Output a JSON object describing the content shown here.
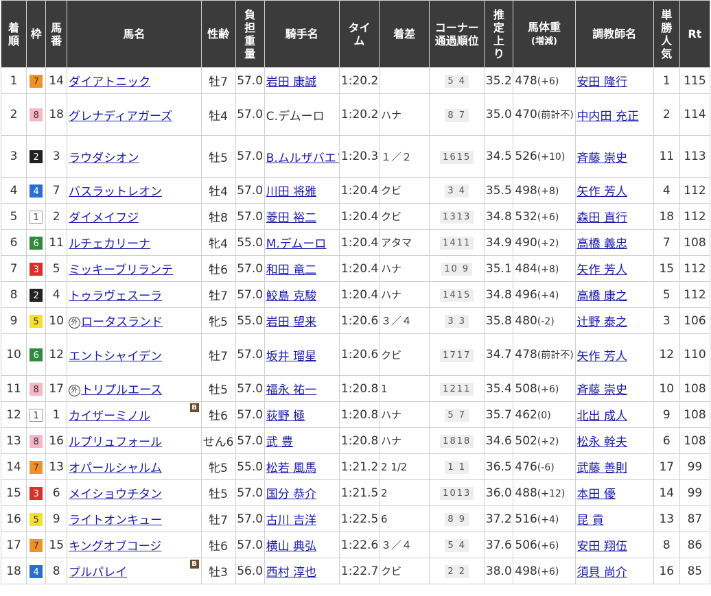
{
  "headers": {
    "rank": "着順",
    "waku": "枠",
    "umaban": "馬番",
    "name": "馬名",
    "sexage": "性齢",
    "weight": "負担重量",
    "jockey": "騎手名",
    "time": "タイム",
    "margin": "着差",
    "corner": "コーナー通過順位",
    "last3f": "推定上り",
    "bodyweight": "馬体重",
    "bodyweight_sub": "(増減)",
    "trainer": "調教師名",
    "pop": "単勝人気",
    "rt": "Rt"
  },
  "waku_colors": {
    "1": {
      "bg": "#ffffff",
      "fg": "#333333"
    },
    "2": {
      "bg": "#222222",
      "fg": "#ffffff"
    },
    "3": {
      "bg": "#d9302c",
      "fg": "#ffffff"
    },
    "4": {
      "bg": "#2a6fcf",
      "fg": "#ffffff"
    },
    "5": {
      "bg": "#f5e02a",
      "fg": "#333333"
    },
    "6": {
      "bg": "#2f8a3c",
      "fg": "#ffffff"
    },
    "7": {
      "bg": "#f0922a",
      "fg": "#333333"
    },
    "8": {
      "bg": "#f6b6c6",
      "fg": "#333333"
    }
  },
  "rows": [
    {
      "rank": "1",
      "waku": "7",
      "umaban": "14",
      "name": "ダイアトニック",
      "gai": false,
      "blinker": false,
      "sexage": "牡7",
      "weight": "57.0",
      "jockey": "岩田 康誠",
      "time": "1:20.2",
      "margin": "",
      "corner": "5 4",
      "last3f": "35.2",
      "bw": "478",
      "bwd": "(+6)",
      "trainer": "安田 隆行",
      "pop": "1",
      "rt": "115"
    },
    {
      "rank": "2",
      "waku": "8",
      "umaban": "18",
      "name": "グレナディアガーズ",
      "gai": false,
      "blinker": false,
      "sexage": "牡4",
      "weight": "57.0",
      "jockey": "C.デムーロ",
      "jockey_plain": true,
      "time": "1:20.2",
      "margin": "ハナ",
      "corner": "8 7",
      "last3f": "35.0",
      "bw": "470",
      "bwd": "(前計不)",
      "trainer": "中内田 充正",
      "pop": "2",
      "rt": "114"
    },
    {
      "rank": "3",
      "waku": "2",
      "umaban": "3",
      "name": "ラウダシオン",
      "gai": false,
      "blinker": false,
      "sexage": "牡5",
      "weight": "57.0",
      "jockey": "B.ムルザバエフ",
      "time": "1:20.3",
      "margin": "１／２",
      "corner": "1615",
      "last3f": "34.5",
      "bw": "526",
      "bwd": "(+10)",
      "trainer": "斉藤 崇史",
      "pop": "11",
      "rt": "113"
    },
    {
      "rank": "4",
      "waku": "4",
      "umaban": "7",
      "name": "バスラットレオン",
      "gai": false,
      "blinker": false,
      "sexage": "牡4",
      "weight": "57.0",
      "jockey": "川田 将雅",
      "time": "1:20.4",
      "margin": "クビ",
      "corner": "3 4",
      "last3f": "35.5",
      "bw": "498",
      "bwd": "(+8)",
      "trainer": "矢作 芳人",
      "pop": "4",
      "rt": "112"
    },
    {
      "rank": "5",
      "waku": "1",
      "umaban": "2",
      "name": "ダイメイフジ",
      "gai": false,
      "blinker": false,
      "sexage": "牡8",
      "weight": "57.0",
      "jockey": "菱田 裕二",
      "time": "1:20.4",
      "margin": "クビ",
      "corner": "1313",
      "last3f": "34.8",
      "bw": "532",
      "bwd": "(+6)",
      "trainer": "森田 直行",
      "pop": "18",
      "rt": "112"
    },
    {
      "rank": "6",
      "waku": "6",
      "umaban": "11",
      "name": "ルチェカリーナ",
      "gai": false,
      "blinker": false,
      "sexage": "牝4",
      "weight": "55.0",
      "jockey": "M.デムーロ",
      "time": "1:20.4",
      "margin": "アタマ",
      "corner": "1411",
      "last3f": "34.9",
      "bw": "490",
      "bwd": "(+2)",
      "trainer": "高橋 義忠",
      "pop": "7",
      "rt": "108"
    },
    {
      "rank": "7",
      "waku": "3",
      "umaban": "5",
      "name": "ミッキーブリランテ",
      "gai": false,
      "blinker": false,
      "sexage": "牡6",
      "weight": "57.0",
      "jockey": "和田 竜二",
      "time": "1:20.4",
      "margin": "ハナ",
      "corner": "10 9",
      "last3f": "35.1",
      "bw": "484",
      "bwd": "(+8)",
      "trainer": "矢作 芳人",
      "pop": "15",
      "rt": "112"
    },
    {
      "rank": "8",
      "waku": "2",
      "umaban": "4",
      "name": "トゥラヴェスーラ",
      "gai": false,
      "blinker": false,
      "sexage": "牡7",
      "weight": "57.0",
      "jockey": "鮫島 克駿",
      "time": "1:20.4",
      "margin": "ハナ",
      "corner": "1415",
      "last3f": "34.8",
      "bw": "496",
      "bwd": "(+4)",
      "trainer": "高橋 康之",
      "pop": "5",
      "rt": "112"
    },
    {
      "rank": "9",
      "waku": "5",
      "umaban": "10",
      "name": "ロータスランド",
      "gai": true,
      "blinker": false,
      "sexage": "牝5",
      "weight": "55.0",
      "jockey": "岩田 望来",
      "time": "1:20.6",
      "margin": "３／４",
      "corner": "3 3",
      "last3f": "35.8",
      "bw": "480",
      "bwd": "(-2)",
      "trainer": "辻野 泰之",
      "pop": "3",
      "rt": "106"
    },
    {
      "rank": "10",
      "waku": "6",
      "umaban": "12",
      "name": "エントシャイデン",
      "gai": false,
      "blinker": false,
      "sexage": "牡7",
      "weight": "57.0",
      "jockey": "坂井 瑠星",
      "time": "1:20.6",
      "margin": "クビ",
      "corner": "1717",
      "last3f": "34.7",
      "bw": "478",
      "bwd": "(前計不)",
      "trainer": "矢作 芳人",
      "pop": "12",
      "rt": "110"
    },
    {
      "rank": "11",
      "waku": "8",
      "umaban": "17",
      "name": "トリプルエース",
      "gai": true,
      "blinker": false,
      "sexage": "牡5",
      "weight": "57.0",
      "jockey": "福永 祐一",
      "time": "1:20.8",
      "margin": "1",
      "corner": "1211",
      "last3f": "35.4",
      "bw": "508",
      "bwd": "(+6)",
      "trainer": "斉藤 崇史",
      "pop": "10",
      "rt": "108"
    },
    {
      "rank": "12",
      "waku": "1",
      "umaban": "1",
      "name": "カイザーミノル",
      "gai": false,
      "blinker": true,
      "sexage": "牡6",
      "weight": "57.0",
      "jockey": "荻野 極",
      "time": "1:20.8",
      "margin": "ハナ",
      "corner": "5 7",
      "last3f": "35.7",
      "bw": "462",
      "bwd": "(0)",
      "trainer": "北出 成人",
      "pop": "9",
      "rt": "108"
    },
    {
      "rank": "13",
      "waku": "8",
      "umaban": "16",
      "name": "ルプリュフォール",
      "gai": false,
      "blinker": false,
      "sexage": "せん6",
      "weight": "57.0",
      "jockey": "武 豊",
      "time": "1:20.8",
      "margin": "ハナ",
      "corner": "1818",
      "last3f": "34.6",
      "bw": "502",
      "bwd": "(+2)",
      "trainer": "松永 幹夫",
      "pop": "6",
      "rt": "108"
    },
    {
      "rank": "14",
      "waku": "7",
      "umaban": "13",
      "name": "オパールシャルム",
      "gai": false,
      "blinker": false,
      "sexage": "牝5",
      "weight": "55.0",
      "jockey": "松若 風馬",
      "time": "1:21.2",
      "margin": "2 1/2",
      "corner": "1 1",
      "last3f": "36.5",
      "bw": "476",
      "bwd": "(-6)",
      "trainer": "武藤 善則",
      "pop": "17",
      "rt": "99"
    },
    {
      "rank": "15",
      "waku": "3",
      "umaban": "6",
      "name": "メイショウチタン",
      "gai": false,
      "blinker": false,
      "sexage": "牡5",
      "weight": "57.0",
      "jockey": "国分 恭介",
      "time": "1:21.5",
      "margin": "2",
      "corner": "1013",
      "last3f": "36.0",
      "bw": "488",
      "bwd": "(+12)",
      "trainer": "本田 優",
      "pop": "14",
      "rt": "99"
    },
    {
      "rank": "16",
      "waku": "5",
      "umaban": "9",
      "name": "ライトオンキュー",
      "gai": false,
      "blinker": false,
      "sexage": "牡7",
      "weight": "57.0",
      "jockey": "古川 吉洋",
      "time": "1:22.5",
      "margin": "6",
      "corner": "8 9",
      "last3f": "37.2",
      "bw": "516",
      "bwd": "(+4)",
      "trainer": "昆 貢",
      "pop": "13",
      "rt": "87"
    },
    {
      "rank": "17",
      "waku": "7",
      "umaban": "15",
      "name": "キングオブコージ",
      "gai": false,
      "blinker": false,
      "sexage": "牡6",
      "weight": "57.0",
      "jockey": "横山 典弘",
      "time": "1:22.6",
      "margin": "３／４",
      "corner": "5 4",
      "last3f": "37.6",
      "bw": "506",
      "bwd": "(+6)",
      "trainer": "安田 翔伍",
      "pop": "8",
      "rt": "86"
    },
    {
      "rank": "18",
      "waku": "4",
      "umaban": "8",
      "name": "プルパレイ",
      "gai": false,
      "blinker": true,
      "sexage": "牡3",
      "weight": "56.0",
      "jockey": "西村 淳也",
      "time": "1:22.7",
      "margin": "クビ",
      "corner": "2 2",
      "last3f": "38.0",
      "bw": "498",
      "bwd": "(+6)",
      "trainer": "須貝 尚介",
      "pop": "16",
      "rt": "85"
    }
  ],
  "icons": {
    "gai_label": "外",
    "blinker_label": "B"
  }
}
